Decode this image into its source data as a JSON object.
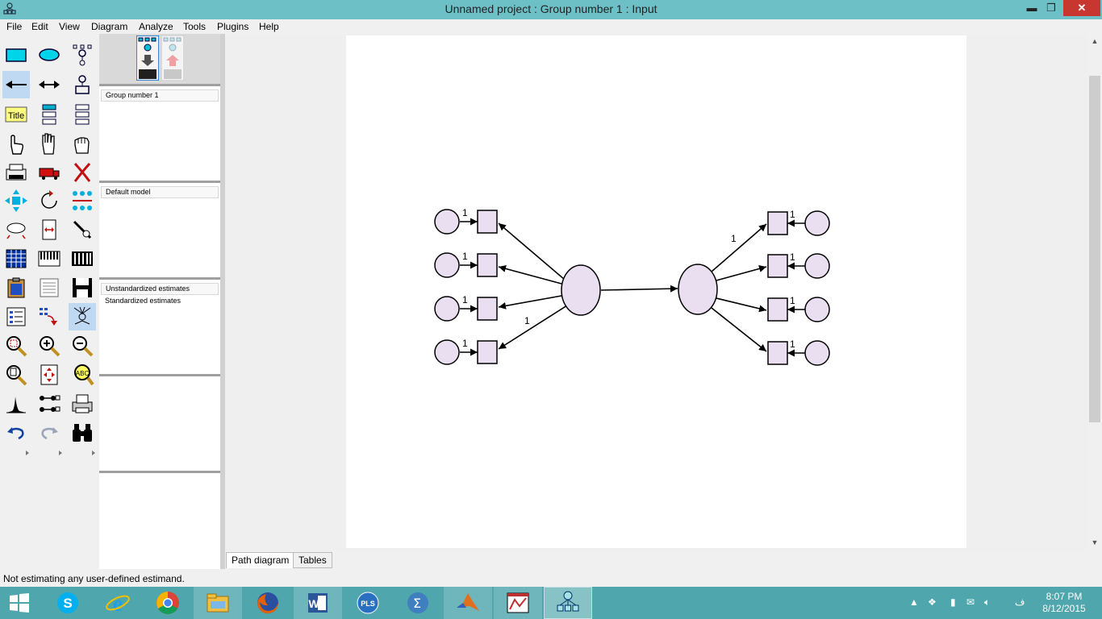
{
  "window": {
    "title": "Unnamed project : Group number 1 : Input",
    "minimize": "▬",
    "maximize": "❐",
    "close": "✕"
  },
  "menu": [
    "File",
    "Edit",
    "View",
    "Diagram",
    "Analyze",
    "Tools",
    "Plugins",
    "Help"
  ],
  "panels": {
    "groups": "Group number 1",
    "models": "Default model",
    "estimates_header": "Unstandardized estimates",
    "estimates_item": "Standardized estimates"
  },
  "diagram": {
    "path_labels": [
      "1",
      "1",
      "1",
      "1",
      "1",
      "1",
      "1",
      "1",
      "1",
      "1"
    ],
    "colors": {
      "fill": "#eadff1",
      "stroke": "#000000"
    }
  },
  "tabs": {
    "path_diagram": "Path diagram",
    "tables": "Tables"
  },
  "status": {
    "message": "Not estimating any user-defined estimand."
  },
  "taskbar": {
    "apps": [
      "windows-start",
      "skype",
      "internet-explorer",
      "chrome",
      "file-explorer",
      "firefox",
      "word",
      "smartpls",
      "sigmaplot",
      "matlab",
      "powerpoint-like",
      "amos"
    ],
    "clock_time": "8:07 PM",
    "clock_date": "8/12/2015",
    "tray_lang": "ف"
  }
}
